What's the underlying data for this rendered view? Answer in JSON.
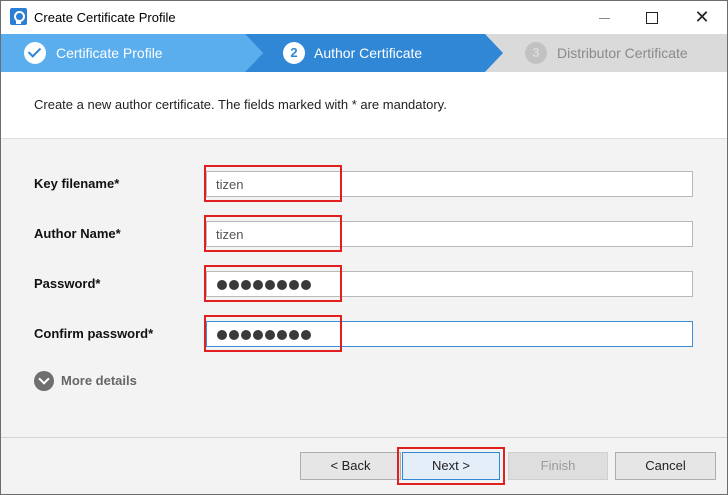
{
  "window": {
    "title": "Create Certificate Profile"
  },
  "steps": [
    {
      "number": "",
      "label": "Certificate Profile",
      "state": "done"
    },
    {
      "number": "2",
      "label": "Author Certificate",
      "state": "active"
    },
    {
      "number": "3",
      "label": "Distributor Certificate",
      "state": "pending"
    }
  ],
  "description": "Create a new author certificate. The fields marked with * are mandatory.",
  "form": {
    "key_filename": {
      "label": "Key filename*",
      "value": "tizen"
    },
    "author_name": {
      "label": "Author Name*",
      "value": "tizen"
    },
    "password": {
      "label": "Password*",
      "masked_length": 8
    },
    "confirm_password": {
      "label": "Confirm password*",
      "masked_length": 8
    }
  },
  "more_details": "More details",
  "buttons": {
    "back": "< Back",
    "next": "Next >",
    "finish": "Finish",
    "cancel": "Cancel"
  },
  "colors": {
    "accent": "#2f87d6",
    "step_done": "#5aaeee",
    "highlight": "#e11f1f"
  }
}
